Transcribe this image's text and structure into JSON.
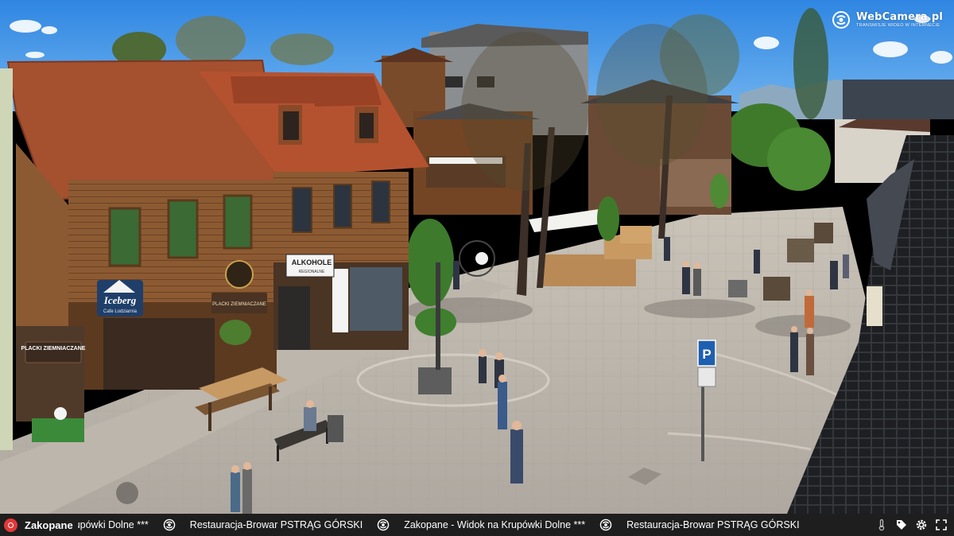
{
  "window": {
    "title": "Zakopane - Widok na Krupówki Dolne"
  },
  "watermark": {
    "brand": "WebCamera.pl",
    "tagline": "TRANSMISJE WIDEO W INTERNECIE",
    "icon": "webcamera-logo-icon"
  },
  "scene_signs": {
    "iceberg": "Iceberg",
    "iceberg_sub": "Cafe Lodziarnia",
    "alkohole": "ALKOHOLE",
    "alkohole_sub": "REGIONALNE",
    "placki": "PLACKI ZIEMNIACZANE",
    "placki_wall": "PLACKI ZIEMNIACZANE"
  },
  "ticker": {
    "live_icon": "live-record-icon",
    "camera_name": "Zakopane",
    "items": [
      {
        "text": "upówki Dolne ***",
        "icon": "webcamera-logo-icon"
      },
      {
        "text": "Restauracja-Browar PSTRĄG GÓRSKI",
        "icon": "webcamera-logo-icon"
      },
      {
        "text": "Zakopane - Widok na Krupówki Dolne ***",
        "icon": "webcamera-logo-icon"
      },
      {
        "text": "Restauracja-Browar PSTRĄG GÓRSKI",
        "icon": ""
      }
    ],
    "controls": [
      {
        "name": "thermometer-icon"
      },
      {
        "name": "tag-icon"
      },
      {
        "name": "settings-gear-icon"
      },
      {
        "name": "fullscreen-icon"
      }
    ]
  },
  "colors": {
    "ticker_bg": "#1e1e1e",
    "live_red": "#e23838",
    "sky": "#3d8fe0",
    "roof_red": "#b4522f",
    "pavement": "#b8b3ac"
  }
}
